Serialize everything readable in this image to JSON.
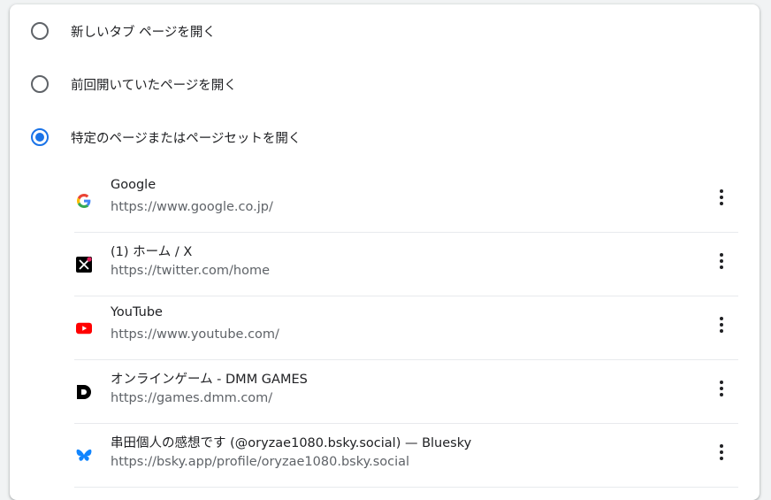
{
  "startup_options": [
    {
      "label": "新しいタブ ページを開く",
      "selected": false
    },
    {
      "label": "前回開いていたページを開く",
      "selected": false
    },
    {
      "label": "特定のページまたはページセットを開く",
      "selected": true
    }
  ],
  "pages": [
    {
      "title": "Google",
      "url": "https://www.google.co.jp/",
      "icon": "google-icon"
    },
    {
      "title": "(1) ホーム / X",
      "url": "https://twitter.com/home",
      "icon": "x-icon"
    },
    {
      "title": "YouTube",
      "url": "https://www.youtube.com/",
      "icon": "youtube-icon"
    },
    {
      "title": "オンラインゲーム - DMM GAMES",
      "url": "https://games.dmm.com/",
      "icon": "dmm-icon"
    },
    {
      "title": "串田個人の感想です (@oryzae1080.bsky.social) — Bluesky",
      "url": "https://bsky.app/profile/oryzae1080.bsky.social",
      "icon": "bluesky-icon"
    }
  ],
  "colors": {
    "accent": "#1a73e8",
    "text": "#202124",
    "secondary_text": "#5f6368"
  }
}
